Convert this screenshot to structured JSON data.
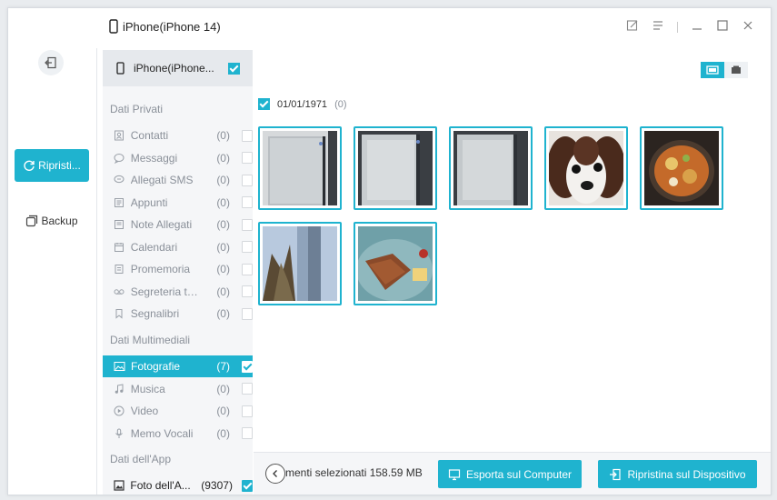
{
  "titlebar": {
    "device_name": "iPhone(iPhone 14)"
  },
  "nav": {
    "restore_label": "Ripristi...",
    "backup_label": "Backup"
  },
  "sidebar": {
    "device_label": "iPhone(iPhone...",
    "private_section": "Dati Privati",
    "private_items": [
      {
        "label": "Contatti",
        "count": "(0)",
        "icon": "contacts-icon"
      },
      {
        "label": "Messaggi",
        "count": "(0)",
        "icon": "message-icon"
      },
      {
        "label": "Allegati SMS",
        "count": "(0)",
        "icon": "sms-attachment-icon"
      },
      {
        "label": "Appunti",
        "count": "(0)",
        "icon": "notes-icon"
      },
      {
        "label": "Note Allegati",
        "count": "(0)",
        "icon": "note-attachment-icon"
      },
      {
        "label": "Calendari",
        "count": "(0)",
        "icon": "calendar-icon"
      },
      {
        "label": "Promemoria",
        "count": "(0)",
        "icon": "reminder-icon"
      },
      {
        "label": "Segreteria tele...",
        "count": "(0)",
        "icon": "voicemail-icon"
      },
      {
        "label": "Segnalibri",
        "count": "(0)",
        "icon": "bookmark-icon"
      }
    ],
    "media_section": "Dati Multimediali",
    "media_items": [
      {
        "label": "Fotografie",
        "count": "(7)",
        "icon": "photo-icon"
      },
      {
        "label": "Musica",
        "count": "(0)",
        "icon": "music-icon"
      },
      {
        "label": "Video",
        "count": "(0)",
        "icon": "video-icon"
      },
      {
        "label": "Memo Vocali",
        "count": "(0)",
        "icon": "voice-memo-icon"
      }
    ],
    "app_section": "Dati dell'App",
    "app_items": [
      {
        "label": "Foto dell'A...",
        "count": "(9307)",
        "icon": "app-photo-icon"
      }
    ]
  },
  "content": {
    "date_label": "01/01/1971",
    "date_count": "(0)",
    "photos": [
      {
        "subject": "screen-glare-1"
      },
      {
        "subject": "screen-glare-2"
      },
      {
        "subject": "screen-glare-3"
      },
      {
        "subject": "puppy"
      },
      {
        "subject": "food-bowl"
      },
      {
        "subject": "tower"
      },
      {
        "subject": "plate-food"
      }
    ]
  },
  "bottom": {
    "selection_text": "menti selezionati 158.59 MB",
    "export_label": "Esporta sul Computer",
    "restore_device_label": "Ripristina sul Dispositivo"
  },
  "colors": {
    "accent": "#1fb3cf"
  }
}
